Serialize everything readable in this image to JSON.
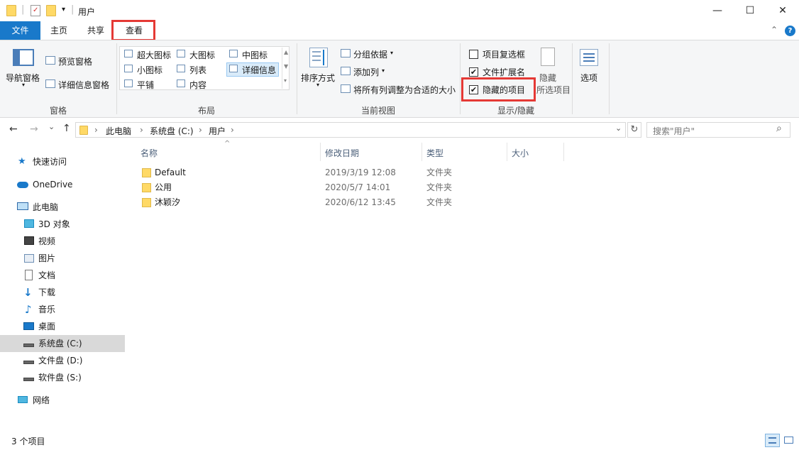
{
  "window": {
    "title": "用户",
    "minimize_glyph": "—",
    "maximize_glyph": "☐",
    "close_glyph": "✕"
  },
  "quick_access": {
    "dropdown_glyph": "▾",
    "separator": "|"
  },
  "tabs": [
    {
      "label": "文件",
      "active": false
    },
    {
      "label": "主页",
      "active": false
    },
    {
      "label": "共享",
      "active": false
    },
    {
      "label": "查看",
      "active": true,
      "highlighted": true
    }
  ],
  "ribbon_controls": {
    "collapse_glyph": "⌃",
    "help_glyph": "?"
  },
  "ribbon": {
    "pane_group": {
      "label": "窗格",
      "nav_pane": "导航窗格",
      "preview_pane": "预览窗格",
      "details_pane": "详细信息窗格"
    },
    "layout_group": {
      "label": "布局",
      "options": [
        "超大图标",
        "大图标",
        "中图标",
        "小图标",
        "列表",
        "详细信息",
        "平铺",
        "内容"
      ],
      "selected": "详细信息"
    },
    "current_view_group": {
      "label": "当前视图",
      "sort_by": "排序方式",
      "group_by": "分组依据",
      "add_columns": "添加列",
      "size_all_columns": "将所有列调整为合适的大小"
    },
    "show_hide_group": {
      "label": "显示/隐藏",
      "item_checkboxes": {
        "label": "项目复选框",
        "checked": false
      },
      "file_extensions": {
        "label": "文件扩展名",
        "checked": true
      },
      "hidden_items": {
        "label": "隐藏的项目",
        "checked": true,
        "highlighted": true
      },
      "hide_selected_line1": "隐藏",
      "hide_selected_line2": "所选项目",
      "check_glyph": "✔"
    },
    "options": {
      "label": "选项"
    }
  },
  "address": {
    "back_glyph": "←",
    "forward_glyph": "→",
    "recent_glyph": "⌄",
    "up_glyph": "↑",
    "sep_glyph": "›",
    "breadcrumb": [
      "此电脑",
      "系统盘 (C:)",
      "用户"
    ],
    "refresh_glyph": "↻",
    "search_placeholder": "搜索\"用户\"",
    "search_glyph": "⌕"
  },
  "nav_pane": {
    "items": [
      {
        "label": "快速访问",
        "icon": "star-icon",
        "indent": false
      },
      {
        "label": "OneDrive",
        "icon": "cloud-icon",
        "indent": false
      },
      {
        "label": "此电脑",
        "icon": "computer-icon",
        "indent": false
      },
      {
        "label": "3D 对象",
        "icon": "cube-icon",
        "indent": true
      },
      {
        "label": "视频",
        "icon": "video-icon",
        "indent": true
      },
      {
        "label": "图片",
        "icon": "picture-icon",
        "indent": true
      },
      {
        "label": "文档",
        "icon": "document-icon",
        "indent": true
      },
      {
        "label": "下载",
        "icon": "download-icon",
        "indent": true
      },
      {
        "label": "音乐",
        "icon": "music-icon",
        "indent": true
      },
      {
        "label": "桌面",
        "icon": "desktop-icon",
        "indent": true
      },
      {
        "label": "系统盘 (C:)",
        "icon": "drive-icon",
        "indent": true,
        "selected": true
      },
      {
        "label": "文件盘 (D:)",
        "icon": "drive-icon",
        "indent": true
      },
      {
        "label": "软件盘 (S:)",
        "icon": "drive-icon",
        "indent": true
      },
      {
        "label": "网络",
        "icon": "network-icon",
        "indent": false
      }
    ]
  },
  "file_list": {
    "sort_glyph": "^",
    "columns": [
      "名称",
      "修改日期",
      "类型",
      "大小"
    ],
    "rows": [
      {
        "name": "Default",
        "modified": "2019/3/19 12:08",
        "type": "文件夹",
        "size": ""
      },
      {
        "name": "公用",
        "modified": "2020/5/7 14:01",
        "type": "文件夹",
        "size": ""
      },
      {
        "name": "沐颖汐",
        "modified": "2020/6/12 13:45",
        "type": "文件夹",
        "size": ""
      }
    ]
  },
  "status": {
    "item_count": "3 个项目"
  },
  "colors": {
    "file_tab": "#1979ca",
    "highlight_box": "#e53935",
    "folder": "#ffd966",
    "selected_nav": "#d9d9d9"
  }
}
